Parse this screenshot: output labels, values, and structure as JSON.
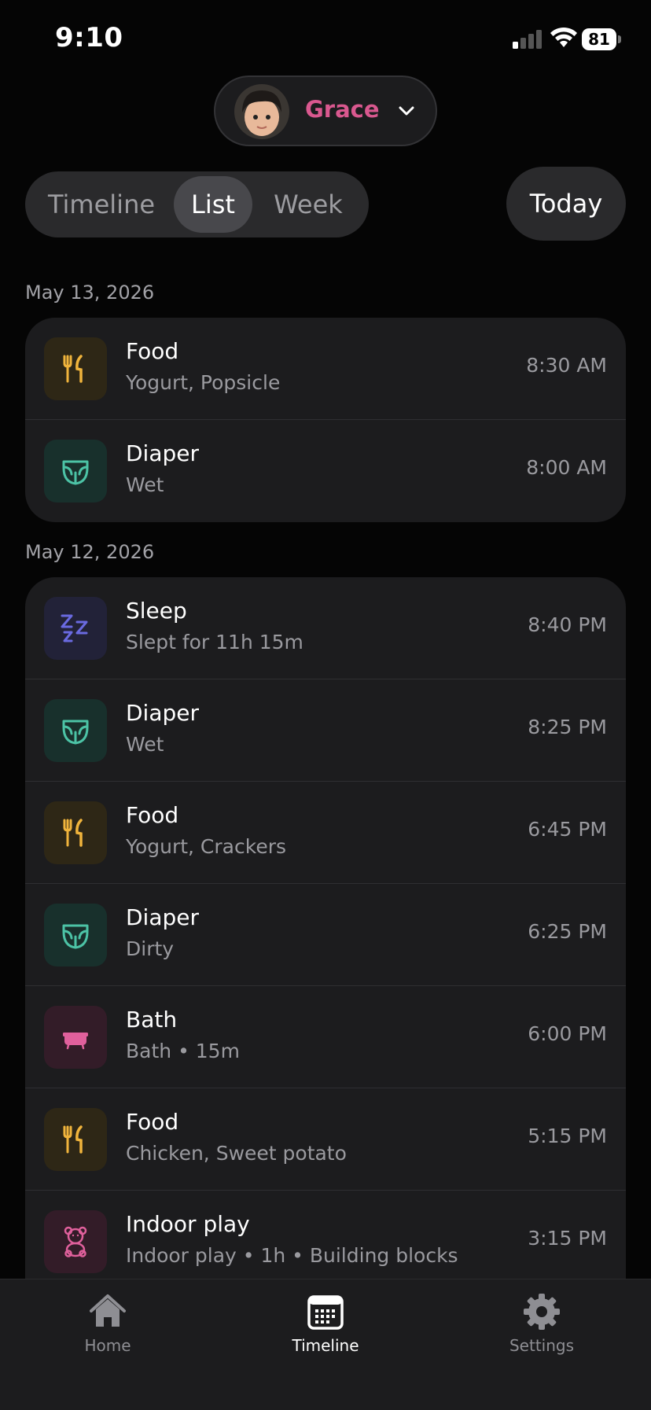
{
  "status_bar": {
    "time": "9:10",
    "battery": "81"
  },
  "profile": {
    "name": "Grace"
  },
  "view_tabs": [
    {
      "label": "Timeline",
      "active": false
    },
    {
      "label": "List",
      "active": true
    },
    {
      "label": "Week",
      "active": false
    }
  ],
  "today_button": "Today",
  "sections": [
    {
      "date": "May 13, 2026",
      "entries": [
        {
          "type": "food",
          "icon": "fork-knife-icon",
          "title": "Food",
          "subtitle": "Yogurt, Popsicle",
          "time": "8:30 AM"
        },
        {
          "type": "diaper",
          "icon": "diaper-icon",
          "title": "Diaper",
          "subtitle": "Wet",
          "time": "8:00 AM"
        }
      ]
    },
    {
      "date": "May 12, 2026",
      "entries": [
        {
          "type": "sleep",
          "icon": "zzz-icon",
          "title": "Sleep",
          "subtitle": "Slept for 11h 15m",
          "time": "8:40 PM"
        },
        {
          "type": "diaper",
          "icon": "diaper-icon",
          "title": "Diaper",
          "subtitle": "Wet",
          "time": "8:25 PM"
        },
        {
          "type": "food",
          "icon": "fork-knife-icon",
          "title": "Food",
          "subtitle": "Yogurt, Crackers",
          "time": "6:45 PM"
        },
        {
          "type": "diaper",
          "icon": "diaper-icon",
          "title": "Diaper",
          "subtitle": "Dirty",
          "time": "6:25 PM"
        },
        {
          "type": "bath",
          "icon": "bathtub-icon",
          "title": "Bath",
          "subtitle": "Bath • 15m",
          "time": "6:00 PM"
        },
        {
          "type": "food",
          "icon": "fork-knife-icon",
          "title": "Food",
          "subtitle": "Chicken, Sweet potato",
          "time": "5:15 PM"
        },
        {
          "type": "play",
          "icon": "teddy-bear-icon",
          "title": "Indoor play",
          "subtitle": "Indoor play • 1h • Building blocks",
          "time": "3:15 PM"
        }
      ]
    }
  ],
  "bottom_tabs": [
    {
      "label": "Home",
      "icon": "home-icon",
      "active": false
    },
    {
      "label": "Timeline",
      "icon": "calendar-icon",
      "active": true
    },
    {
      "label": "Settings",
      "icon": "gear-icon",
      "active": false
    }
  ],
  "colors": {
    "accent_name": "#d9588f",
    "food": "#f0b43c",
    "diaper": "#4cc3a6",
    "sleep": "#6a6ae0",
    "bath": "#e0609c"
  }
}
